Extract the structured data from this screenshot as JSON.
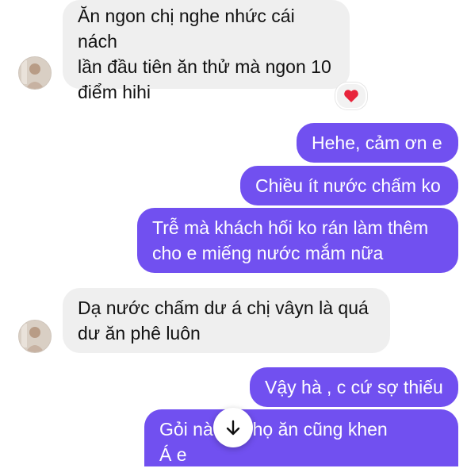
{
  "messages": [
    {
      "direction": "incoming",
      "text": "Ăn ngon chị nghe nhức cái nách\nlần đầu tiên ăn thử mà ngon 10\nđiểm hihi"
    },
    {
      "direction": "outgoing",
      "text": "Hehe, cảm ơn e"
    },
    {
      "direction": "outgoing",
      "text": "Chiều ít nước chấm ko"
    },
    {
      "direction": "outgoing",
      "text": "Trễ mà khách hối ko rán làm thêm\ncho e miếng nước mắm nữa"
    },
    {
      "direction": "incoming",
      "text": "Dạ nước chấm dư á chị vâyn là quá\ndư ăn phê luôn"
    },
    {
      "direction": "outgoing",
      "text": "Vậy hà , c cứ sợ thiếu"
    },
    {
      "direction": "outgoing",
      "text": "Gỏi nà          đây họ ăn cũng khen\nÁ e"
    }
  ],
  "reaction": {
    "icon": "heart-icon",
    "color": "#e8243b"
  },
  "scroll_button": {
    "icon": "arrow-down-icon"
  },
  "colors": {
    "outgoing_bubble": "#7150f0",
    "incoming_bubble": "#efefef"
  }
}
